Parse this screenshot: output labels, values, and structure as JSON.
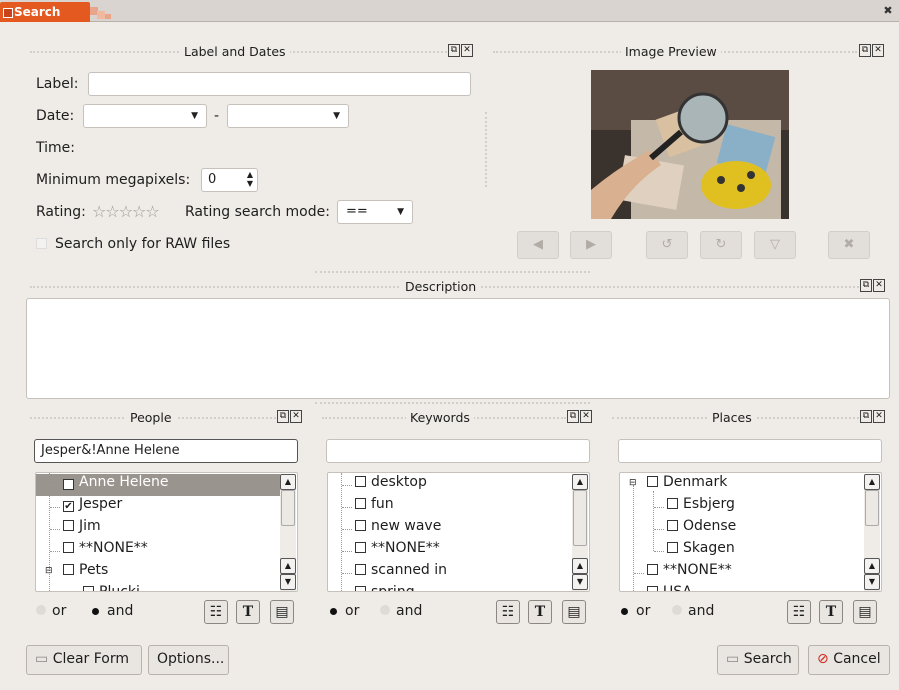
{
  "window": {
    "title": "Search"
  },
  "label_dates": {
    "header": "Label and Dates",
    "label_label": "Label:",
    "label_value": "",
    "date_label": "Date:",
    "date_separator": "-",
    "time_label": "Time:",
    "min_mp_label": "Minimum megapixels:",
    "min_mp_value": "0",
    "rating_label": "Rating:",
    "rating_stars": "☆☆☆☆☆",
    "rating_mode_label": "Rating search mode:",
    "rating_mode_value": "==",
    "raw_label": "Search only for RAW files"
  },
  "preview": {
    "header": "Image Preview"
  },
  "description": {
    "header": "Description",
    "value": ""
  },
  "people": {
    "header": "People",
    "search_value": "Jesper&!Anne Helene",
    "items": [
      {
        "label": "Anne Helene",
        "checked": true,
        "selected": true
      },
      {
        "label": "Jesper",
        "checked": true
      },
      {
        "label": "Jim",
        "checked": false
      },
      {
        "label": "**NONE**",
        "checked": false
      },
      {
        "label": "Pets",
        "checked": false
      },
      {
        "label": "Plucki",
        "checked": false
      }
    ],
    "or_label": "or",
    "and_label": "and",
    "mode": "and"
  },
  "keywords": {
    "header": "Keywords",
    "search_value": "",
    "items": [
      {
        "label": "desktop"
      },
      {
        "label": "fun"
      },
      {
        "label": "new wave"
      },
      {
        "label": "**NONE**"
      },
      {
        "label": "scanned in"
      },
      {
        "label": "spring"
      }
    ],
    "or_label": "or",
    "and_label": "and",
    "mode": "or"
  },
  "places": {
    "header": "Places",
    "search_value": "",
    "items": [
      {
        "label": "Denmark"
      },
      {
        "label": "Esbjerg"
      },
      {
        "label": "Odense"
      },
      {
        "label": "Skagen"
      },
      {
        "label": "**NONE**"
      },
      {
        "label": "USA"
      }
    ],
    "or_label": "or",
    "and_label": "and",
    "mode": "or"
  },
  "buttons": {
    "clear": "Clear Form",
    "options": "Options...",
    "search": "Search",
    "cancel": "Cancel"
  }
}
